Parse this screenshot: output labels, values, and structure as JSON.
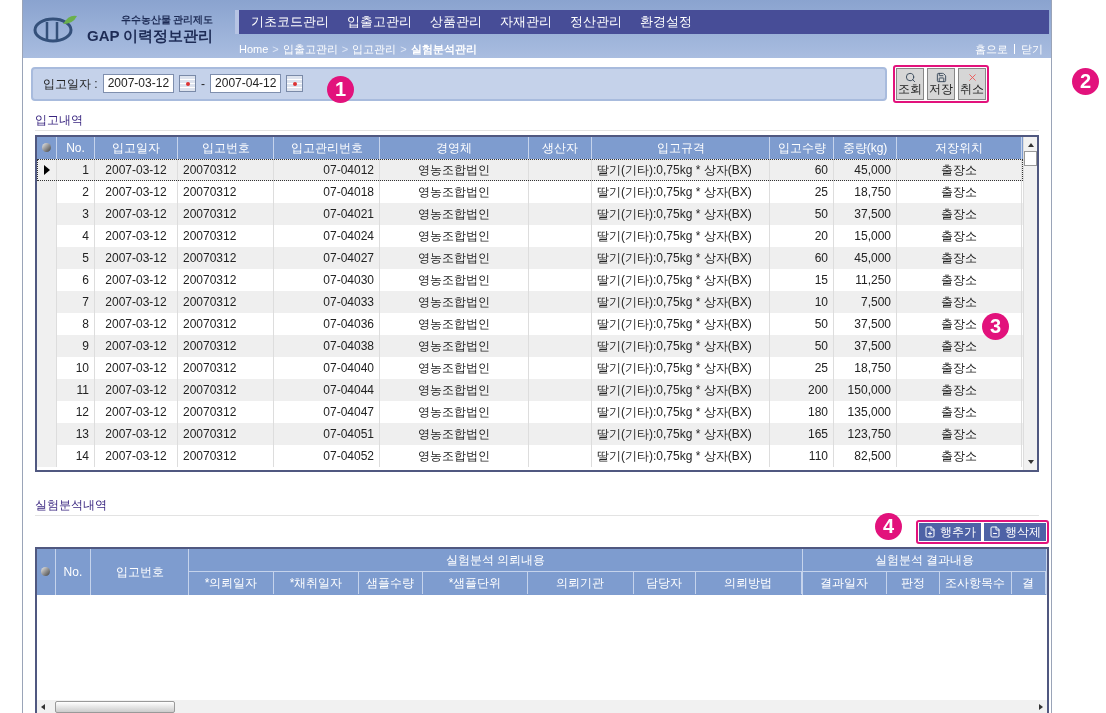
{
  "logo": {
    "subtitle": "우수농산물 관리제도",
    "title": "GAP 이력정보관리"
  },
  "nav": [
    {
      "label": "기초코드관리"
    },
    {
      "label": "입출고관리"
    },
    {
      "label": "상품관리"
    },
    {
      "label": "자재관리"
    },
    {
      "label": "정산관리"
    },
    {
      "label": "환경설정"
    }
  ],
  "breadcrumb": [
    "Home",
    "입출고관리",
    "입고관리",
    "실험분석관리"
  ],
  "breadcrumb_separator": ">",
  "top_links": [
    "홈으로",
    "닫기"
  ],
  "filter": {
    "label": "입고일자 :",
    "from": "2007-03-12",
    "separator": "-",
    "to": "2007-04-12"
  },
  "toolbar_buttons": [
    {
      "label": "조회",
      "kind": "search"
    },
    {
      "label": "저장",
      "kind": "save"
    },
    {
      "label": "취소",
      "kind": "cancel"
    }
  ],
  "receipts": {
    "title": "입고내역",
    "columns": [
      "No.",
      "입고일자",
      "입고번호",
      "입고관리번호",
      "경영체",
      "생산자",
      "입고규격",
      "입고수량",
      "중량(kg)",
      "저장위치"
    ],
    "rows": [
      {
        "selected": true,
        "cells": [
          "1",
          "2007-03-12",
          "20070312",
          "07-04012",
          "영농조합법인",
          "",
          "딸기(기타):0,75kg * 상자(BX)",
          "60",
          "45,000",
          "출장소"
        ]
      },
      {
        "selected": false,
        "cells": [
          "2",
          "2007-03-12",
          "20070312",
          "07-04018",
          "영농조합법인",
          "",
          "딸기(기타):0,75kg * 상자(BX)",
          "25",
          "18,750",
          "출장소"
        ]
      },
      {
        "selected": false,
        "cells": [
          "3",
          "2007-03-12",
          "20070312",
          "07-04021",
          "영농조합법인",
          "",
          "딸기(기타):0,75kg * 상자(BX)",
          "50",
          "37,500",
          "출장소"
        ]
      },
      {
        "selected": false,
        "cells": [
          "4",
          "2007-03-12",
          "20070312",
          "07-04024",
          "영농조합법인",
          "",
          "딸기(기타):0,75kg * 상자(BX)",
          "20",
          "15,000",
          "출장소"
        ]
      },
      {
        "selected": false,
        "cells": [
          "5",
          "2007-03-12",
          "20070312",
          "07-04027",
          "영농조합법인",
          "",
          "딸기(기타):0,75kg * 상자(BX)",
          "60",
          "45,000",
          "출장소"
        ]
      },
      {
        "selected": false,
        "cells": [
          "6",
          "2007-03-12",
          "20070312",
          "07-04030",
          "영농조합법인",
          "",
          "딸기(기타):0,75kg * 상자(BX)",
          "15",
          "11,250",
          "출장소"
        ]
      },
      {
        "selected": false,
        "cells": [
          "7",
          "2007-03-12",
          "20070312",
          "07-04033",
          "영농조합법인",
          "",
          "딸기(기타):0,75kg * 상자(BX)",
          "10",
          "7,500",
          "출장소"
        ]
      },
      {
        "selected": false,
        "cells": [
          "8",
          "2007-03-12",
          "20070312",
          "07-04036",
          "영농조합법인",
          "",
          "딸기(기타):0,75kg * 상자(BX)",
          "50",
          "37,500",
          "출장소"
        ]
      },
      {
        "selected": false,
        "cells": [
          "9",
          "2007-03-12",
          "20070312",
          "07-04038",
          "영농조합법인",
          "",
          "딸기(기타):0,75kg * 상자(BX)",
          "50",
          "37,500",
          "출장소"
        ]
      },
      {
        "selected": false,
        "cells": [
          "10",
          "2007-03-12",
          "20070312",
          "07-04040",
          "영농조합법인",
          "",
          "딸기(기타):0,75kg * 상자(BX)",
          "25",
          "18,750",
          "출장소"
        ]
      },
      {
        "selected": false,
        "cells": [
          "11",
          "2007-03-12",
          "20070312",
          "07-04044",
          "영농조합법인",
          "",
          "딸기(기타):0,75kg * 상자(BX)",
          "200",
          "150,000",
          "출장소"
        ]
      },
      {
        "selected": false,
        "cells": [
          "12",
          "2007-03-12",
          "20070312",
          "07-04047",
          "영농조합법인",
          "",
          "딸기(기타):0,75kg * 상자(BX)",
          "180",
          "135,000",
          "출장소"
        ]
      },
      {
        "selected": false,
        "cells": [
          "13",
          "2007-03-12",
          "20070312",
          "07-04051",
          "영농조합법인",
          "",
          "딸기(기타):0,75kg * 상자(BX)",
          "165",
          "123,750",
          "출장소"
        ]
      },
      {
        "selected": false,
        "cells": [
          "14",
          "2007-03-12",
          "20070312",
          "07-04052",
          "영농조합법인",
          "",
          "딸기(기타):0,75kg * 상자(BX)",
          "110",
          "82,500",
          "출장소"
        ]
      }
    ]
  },
  "analysis": {
    "title": "실험분석내역",
    "buttons": [
      {
        "label": "행추가",
        "kind": "add"
      },
      {
        "label": "행삭제",
        "kind": "delete"
      }
    ],
    "columns": [
      "No.",
      "입고번호"
    ],
    "groups": [
      {
        "label": "실험분석 의뢰내용",
        "columns": [
          "*의뢰일자",
          "*채취일자",
          "샘플수량",
          "*샘플단위",
          "의뢰기관",
          "담당자",
          "의뢰방법"
        ]
      },
      {
        "label": "실험분석 결과내용",
        "columns": [
          "결과일자",
          "판정",
          "조사항목수",
          "결"
        ]
      }
    ]
  },
  "callouts": [
    "1",
    "2",
    "3",
    "4"
  ]
}
